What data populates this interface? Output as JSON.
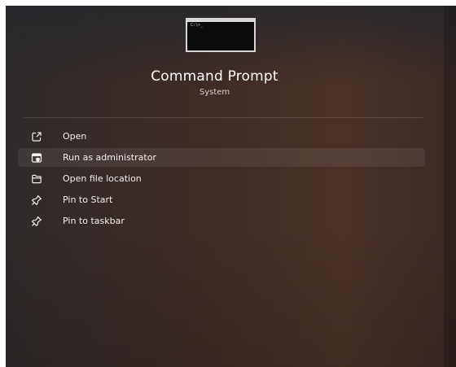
{
  "app": {
    "title": "Command Prompt",
    "subtitle": "System",
    "icon": "command-prompt-icon",
    "icon_prompt_text": "C:\\>_"
  },
  "menu": {
    "items": [
      {
        "label": "Open",
        "icon": "open-external-icon"
      },
      {
        "label": "Run as administrator",
        "icon": "admin-shield-window-icon"
      },
      {
        "label": "Open file location",
        "icon": "folder-icon"
      },
      {
        "label": "Pin to Start",
        "icon": "pin-icon"
      },
      {
        "label": "Pin to taskbar",
        "icon": "pin-icon"
      }
    ],
    "highlighted_item": "Run as administrator"
  },
  "colors": {
    "panel_background": "#3f2c26",
    "text": "#f2efed",
    "subtext": "#d6d0cc"
  }
}
